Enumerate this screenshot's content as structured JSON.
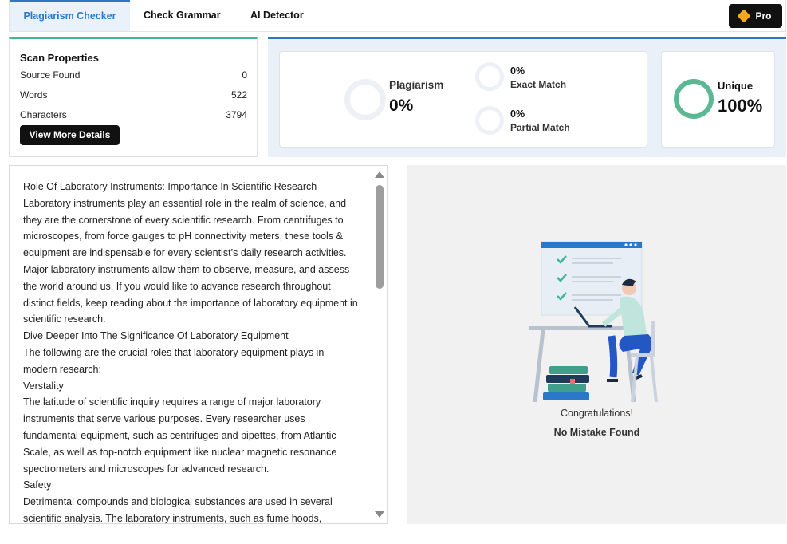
{
  "tabs": [
    {
      "label": "Plagiarism Checker",
      "active": true
    },
    {
      "label": "Check Grammar",
      "active": false
    },
    {
      "label": "AI Detector",
      "active": false
    }
  ],
  "pro_button": {
    "label": "Pro",
    "icon": "diamond-icon"
  },
  "scan_properties": {
    "title": "Scan Properties",
    "rows": [
      {
        "label": "Source Found",
        "value": "0"
      },
      {
        "label": "Words",
        "value": "522"
      },
      {
        "label": "Characters",
        "value": "3794"
      }
    ],
    "button": "View More Details"
  },
  "results": {
    "plagiarism": {
      "label": "Plagiarism",
      "value": "0%"
    },
    "exact_match": {
      "label": "Exact Match",
      "value": "0%"
    },
    "partial_match": {
      "label": "Partial Match",
      "value": "0%"
    },
    "unique": {
      "label": "Unique",
      "value": "100%"
    }
  },
  "text_content": [
    "Role Of Laboratory Instruments: Importance In Scientific Research",
    "Laboratory instruments play an essential role in the realm of science, and they are the cornerstone of every scientific research. From centrifuges to microscopes, from force gauges to pH connectivity meters, these tools & equipment are indispensable for every scientist’s daily research activities. Major laboratory instruments allow them to observe, measure, and assess the world around us. If you would like to advance research throughout distinct fields, keep reading about the importance of laboratory equipment in scientific research.",
    "Dive Deeper Into The Significance Of Laboratory Equipment",
    "The following are the crucial roles that laboratory equipment plays in modern research:",
    "Verstality",
    "The latitude of scientific inquiry requires a range of major laboratory instruments that serve various purposes. Every researcher uses fundamental equipment, such as centrifuges and pipettes, from Atlantic Scale, as well as top-notch equipment like nuclear magnetic resonance spectrometers and microscopes for advanced research.",
    "Safety",
    "Detrimental compounds and biological substances are used in several scientific analysis. The laboratory instruments, such as fume hoods,"
  ],
  "status": {
    "congrats": "Congratulations!",
    "no_mistake": "No Mistake Found"
  },
  "colors": {
    "accent_blue": "#2b78c8",
    "unique_green": "#5cb793",
    "pro_diamond": "#f4a81d"
  }
}
